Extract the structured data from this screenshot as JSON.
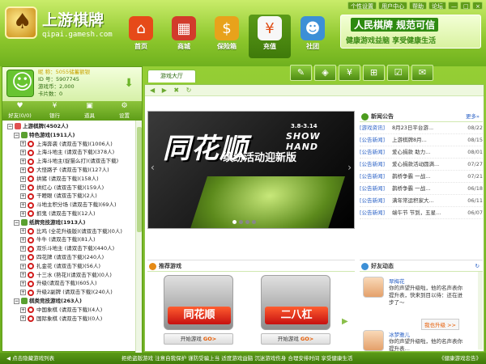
{
  "app": {
    "name": "上游棋牌",
    "url": "qipai.gamesh.com"
  },
  "topbar": [
    "个性设置",
    "用户中心",
    "帮助",
    "论坛"
  ],
  "window_buttons": [
    "—",
    "□",
    "×"
  ],
  "nav": [
    {
      "label": "首页",
      "icon": "home-icon",
      "glyph": "⌂"
    },
    {
      "label": "商城",
      "icon": "shop-icon",
      "glyph": "▦"
    },
    {
      "label": "保险箱",
      "icon": "safe-icon",
      "glyph": "$"
    },
    {
      "label": "充值",
      "icon": "recharge-icon",
      "glyph": "¥"
    },
    {
      "label": "社团",
      "icon": "community-icon",
      "glyph": "☻"
    }
  ],
  "ad": {
    "title": "人民棋牌 规范可信",
    "subtitle": "健康游戏益脑 享受健康生活"
  },
  "user": {
    "nickname": "昵  称：5055储蓄额银",
    "id": "ID  号：5907745",
    "coins": "游戏币：2,000",
    "cards": "卡片数：0"
  },
  "left_tabs": [
    {
      "label": "好友(0/0)",
      "icon": "friends-icon",
      "glyph": "♥"
    },
    {
      "label": "银行",
      "icon": "bank-icon",
      "glyph": "¥"
    },
    {
      "label": "道具",
      "icon": "props-icon",
      "glyph": "▣"
    },
    {
      "label": "设置",
      "icon": "settings-icon",
      "glyph": "⚙"
    }
  ],
  "tree": [
    {
      "text": "上游棋牌(4502人)",
      "level": 0,
      "bold": true,
      "type": "root"
    },
    {
      "text": "特色游戏(1911人)",
      "level": 1,
      "bold": true,
      "type": "group"
    },
    {
      "text": "上海奔袭 (请双击下载)(1006人)",
      "level": 2,
      "type": "game"
    },
    {
      "text": "上海斗地主 (请双击下载)(378人)",
      "level": 2,
      "type": "game"
    },
    {
      "text": "上海斗地主(捉猫么打)(请双击下载)",
      "level": 2,
      "type": "game"
    },
    {
      "text": "大怪路子 (请双击下载)(127人)",
      "level": 2,
      "type": "game"
    },
    {
      "text": "拱猪 (请双击下载)(158人)",
      "level": 2,
      "type": "game"
    },
    {
      "text": "拱红心 (请双击下载)(159人)",
      "level": 2,
      "type": "game"
    },
    {
      "text": "干瞪眼 (请双击下载)(2人)",
      "level": 2,
      "type": "game"
    },
    {
      "text": "斗地主积分场 (请双击下载)(69人)",
      "level": 2,
      "type": "game"
    },
    {
      "text": "抓鬼 (请双击下载)(12人)",
      "level": 2,
      "type": "game"
    },
    {
      "text": "纸牌竞技游戏(1913人)",
      "level": 1,
      "bold": true,
      "type": "group"
    },
    {
      "text": "比鸡 (全花升级版)(请双击下载)(0人)",
      "level": 2,
      "type": "game"
    },
    {
      "text": "牛牛 (请双击下载)(81人)",
      "level": 2,
      "type": "game"
    },
    {
      "text": "双乐斗地主 (请双击下载)(440人)",
      "level": 2,
      "type": "game"
    },
    {
      "text": "四花牌 (请双击下载)(240人)",
      "level": 2,
      "type": "game"
    },
    {
      "text": "扎金花 (请双击下载)(56人)",
      "level": 2,
      "type": "game"
    },
    {
      "text": "十三水 (熟花)(请双击下载)(0人)",
      "level": 2,
      "type": "game"
    },
    {
      "text": "升级(请双击下载)(605人)",
      "level": 2,
      "type": "game"
    },
    {
      "text": "升级2副牌 (请双击下载)(240人)",
      "level": 2,
      "type": "game"
    },
    {
      "text": "棋类竞技游戏(263人)",
      "level": 1,
      "bold": true,
      "type": "group"
    },
    {
      "text": "中国象棋 (请双击下载)(4人)",
      "level": 2,
      "type": "game"
    },
    {
      "text": "国际象棋 (请双击下载)(0人)",
      "level": 2,
      "type": "game"
    }
  ],
  "tab_lobby": "游戏大厅",
  "tool_icons": [
    {
      "icon": "notepad-icon",
      "glyph": "✎"
    },
    {
      "icon": "shield-icon",
      "glyph": "◈"
    },
    {
      "icon": "yen-icon",
      "glyph": "¥"
    },
    {
      "icon": "gift-icon",
      "glyph": "⊞"
    },
    {
      "icon": "check-icon",
      "glyph": "☑"
    },
    {
      "icon": "mail-icon",
      "glyph": "✉"
    }
  ],
  "browser_nav": "◀ ▶ ✖ ↻",
  "banner": {
    "title": "同花顺",
    "date": "3.8-3.14",
    "english": "SHOW HAND",
    "subtitle": "缤纷活动迎新版"
  },
  "news": {
    "title": "新闻公告",
    "more": "更多»",
    "items": [
      {
        "cat": "[游戏资讯]",
        "title": "8月23日平台游...",
        "date": "08/22"
      },
      {
        "cat": "[公告新闻]",
        "title": "上游棋牌8月...",
        "date": "08/15"
      },
      {
        "cat": "[公告新闻]",
        "title": "爱心捐款 助力...",
        "date": "08/01"
      },
      {
        "cat": "[公告新闻]",
        "title": "爱心捐款活动圆满...",
        "date": "07/27"
      },
      {
        "cat": "[公告新闻]",
        "title": "鹊桥争霸 一战...",
        "date": "07/21"
      },
      {
        "cat": "[公告新闻]",
        "title": "鹊桥争霸 一战...",
        "date": "06/18"
      },
      {
        "cat": "[公告新闻]",
        "title": "满年常运积家大...",
        "date": "06/11"
      },
      {
        "cat": "[公告新闻]",
        "title": "端午节 节到，五星...",
        "date": "06/07"
      }
    ]
  },
  "rec": {
    "title": "推荐游戏",
    "games": [
      {
        "name": "同花顺",
        "start": "开始游戏",
        "go": "GO>"
      },
      {
        "name": "二八杠",
        "start": "开始游戏",
        "go": "GO>"
      }
    ]
  },
  "friends": {
    "title": "好友动态",
    "items": [
      {
        "name": "翠梅花",
        "msg": "你的声望升级啦，他的名声表你提升表，快来到目以待：还在进步了～",
        "btn": "我也升级 >>"
      },
      {
        "name": "冰梦雅儿",
        "msg": "你的声望升级啦，他的名声表你提升表…"
      }
    ]
  },
  "status": {
    "hide": "◀ 点击隐藏游戏列表",
    "ticker": "拒绝盗版游戏 注意自我保护 谨防受骗上当 适度游戏益脑 沉迷游戏伤身 合理安排时间 享受健康生活",
    "right": "《健康游戏忠告》"
  }
}
